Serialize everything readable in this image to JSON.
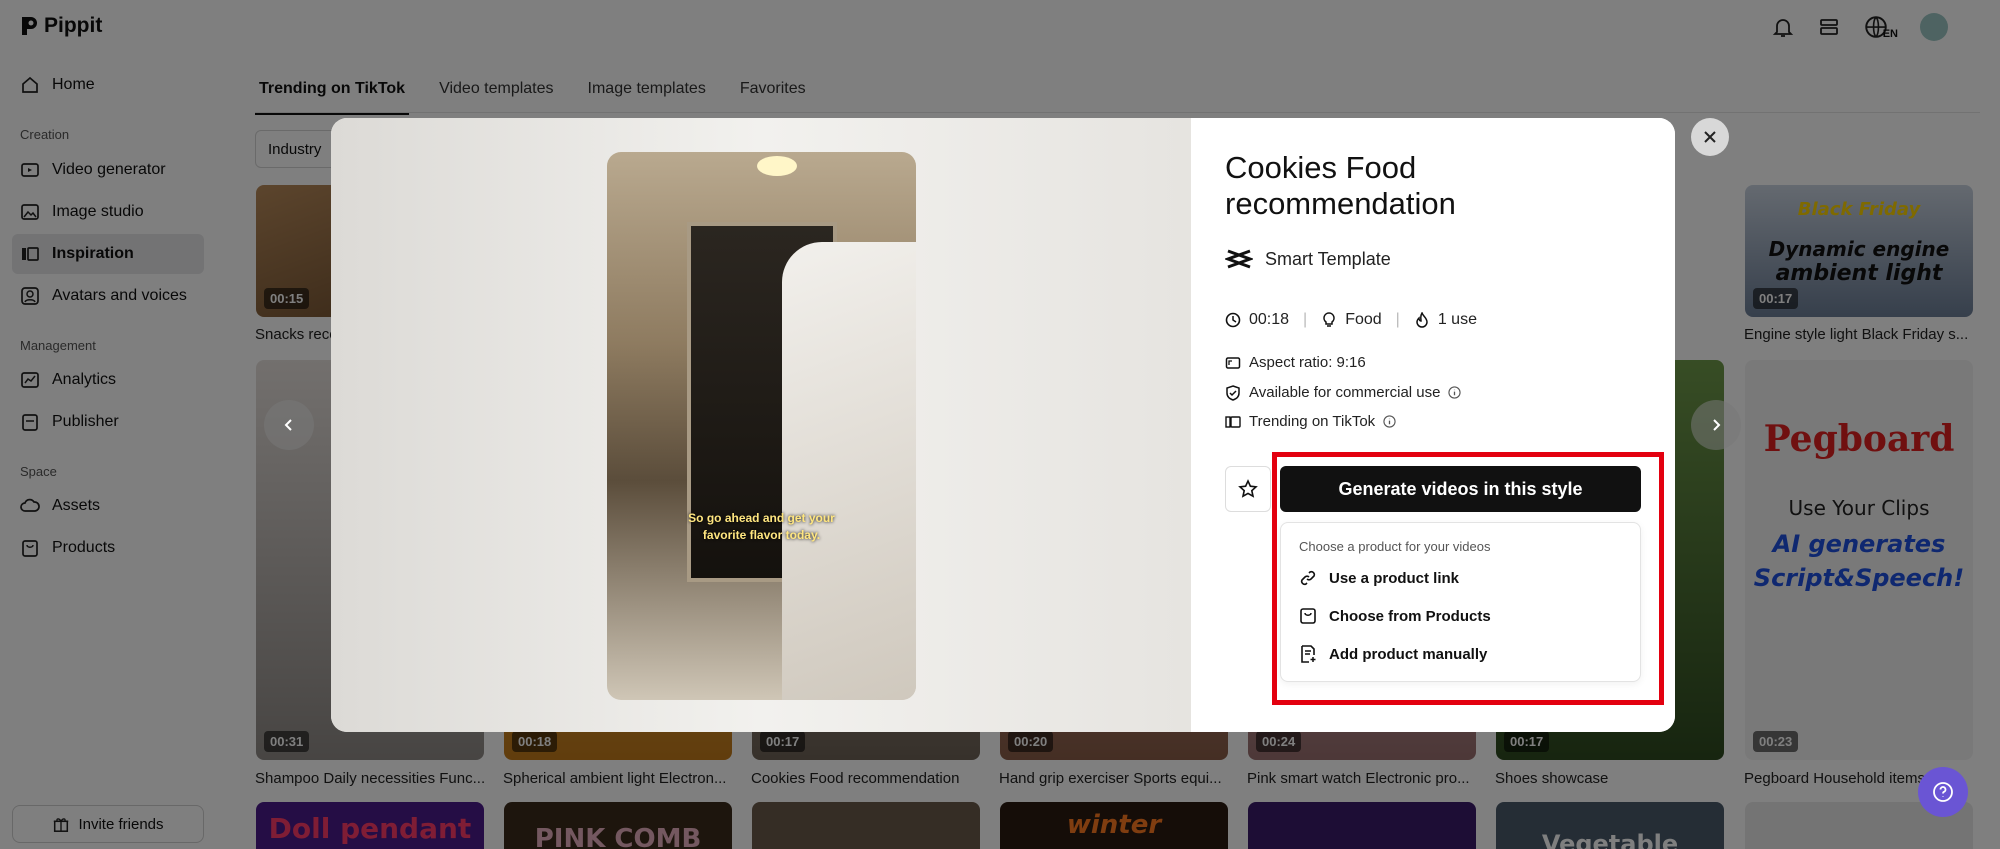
{
  "app": {
    "name": "Pippit",
    "lang_badge": "EN"
  },
  "sidebar": {
    "home": "Home",
    "creation_label": "Creation",
    "video_generator": "Video generator",
    "image_studio": "Image studio",
    "inspiration": "Inspiration",
    "avatars": "Avatars and voices",
    "management_label": "Management",
    "analytics": "Analytics",
    "publisher": "Publisher",
    "space_label": "Space",
    "assets": "Assets",
    "products": "Products",
    "invite": "Invite friends"
  },
  "tabs": [
    "Trending on TikTok",
    "Video templates",
    "Image templates",
    "Favorites"
  ],
  "filter": {
    "label": "Industry"
  },
  "grid": {
    "row1": [
      {
        "duration": "00:15",
        "title": "Snacks reco"
      },
      {
        "duration": "00:17",
        "title": "Engine style light Black Friday s...",
        "thumb_line1": "Black Friday",
        "thumb_line2": "Dynamic engine",
        "thumb_line3": "ambient light"
      }
    ],
    "row2": [
      {
        "duration": "00:31",
        "title": "Shampoo Daily necessities Func..."
      },
      {
        "duration": "00:18",
        "title": "Spherical ambient light Electron..."
      },
      {
        "duration": "00:17",
        "title": "Cookies Food recommendation"
      },
      {
        "duration": "00:20",
        "title": "Hand grip exerciser Sports equi..."
      },
      {
        "duration": "00:24",
        "title": "Pink smart watch Electronic pro..."
      },
      {
        "duration": "00:17",
        "title": "Shoes showcase"
      },
      {
        "duration": "00:23",
        "title": "Pegboard Household items",
        "thumb_line1": "Pegboard",
        "thumb_line2": "Use Your Clips",
        "thumb_line3": "AI generates",
        "thumb_line4": "Script&Speech!"
      }
    ],
    "row3": [
      "Doll pendant",
      "PINK COMB",
      "",
      "winter",
      "",
      "Vegetable",
      ""
    ]
  },
  "modal": {
    "title": "Cookies Food recommendation",
    "template_type": "Smart Template",
    "duration": "00:18",
    "category": "Food",
    "uses": "1 use",
    "aspect_ratio": "Aspect ratio: 9:16",
    "commercial": "Available for commercial use",
    "trending": "Trending on TikTok",
    "subtitle_line1": "So go ahead and get your",
    "subtitle_line2": "favorite flavor today.",
    "generate_button": "Generate videos in this style",
    "dropdown": {
      "header": "Choose a product for your videos",
      "items": [
        "Use a product link",
        "Choose from Products",
        "Add product manually"
      ]
    }
  },
  "colors": {
    "highlight": "#e3000f",
    "primary_button": "#111111",
    "help": "#6a55d4"
  }
}
